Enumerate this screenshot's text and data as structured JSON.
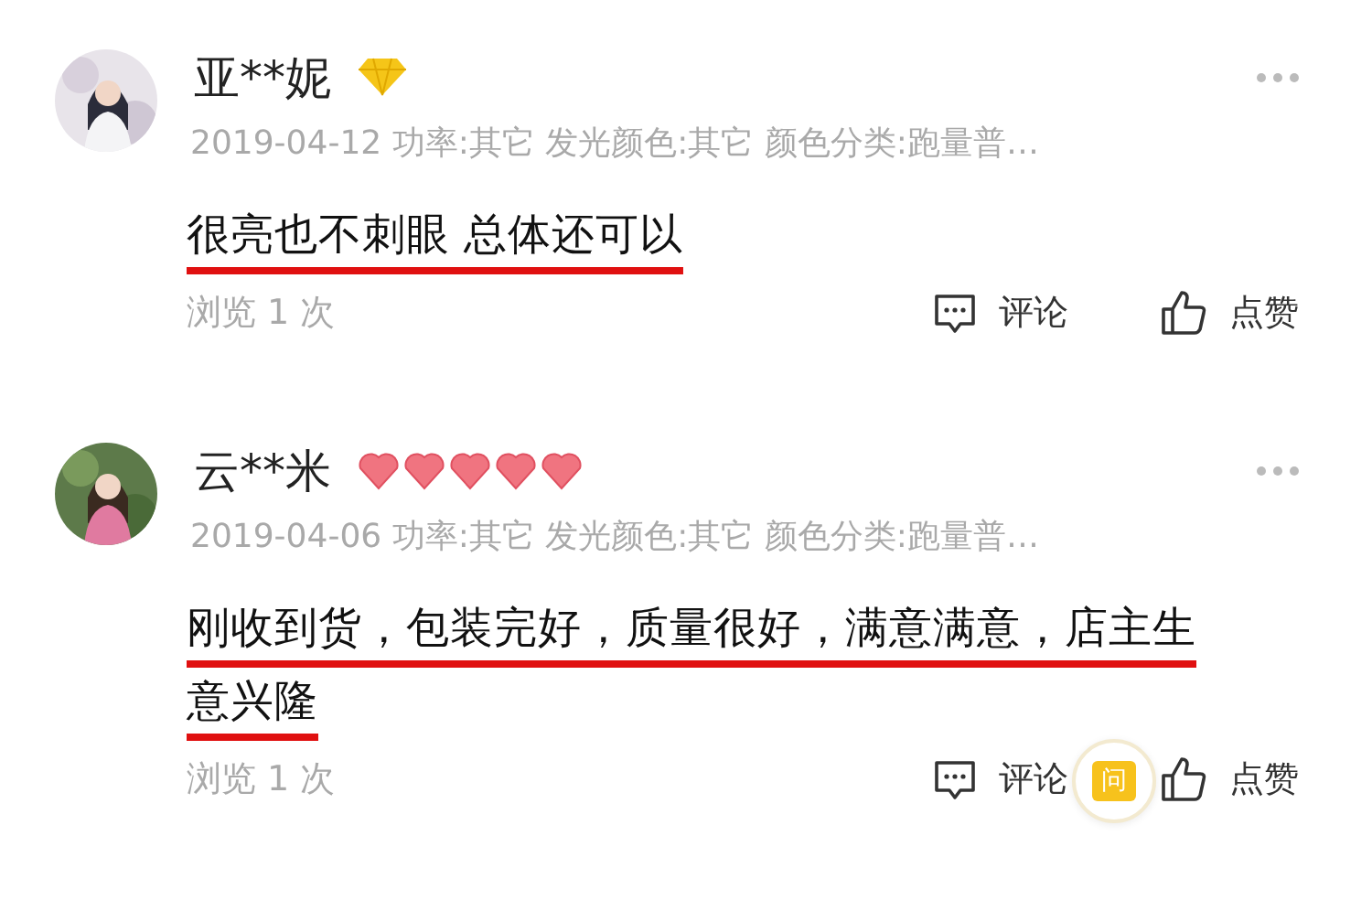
{
  "reviews": [
    {
      "user": "亚**妮",
      "badge": {
        "kind": "diamond"
      },
      "meta": "2019-04-12 功率:其它 发光颜色:其它 颜色分类:跑量普…",
      "comment": "很亮也不刺眼 总体还可以",
      "underlined": true,
      "views": "浏览 1 次",
      "comment_action": "评论",
      "like_action": "点赞"
    },
    {
      "user": "云**米",
      "badge": {
        "kind": "hearts"
      },
      "meta": "2019-04-06 功率:其它 发光颜色:其它 颜色分类:跑量普…",
      "comment": "刚收到货，包装完好，质量很好，满意满意，店主生意兴隆",
      "underlined": true,
      "views": "浏览 1 次",
      "comment_action": "评论",
      "like_action": "点赞"
    }
  ],
  "ask_button": {
    "label": "问"
  }
}
